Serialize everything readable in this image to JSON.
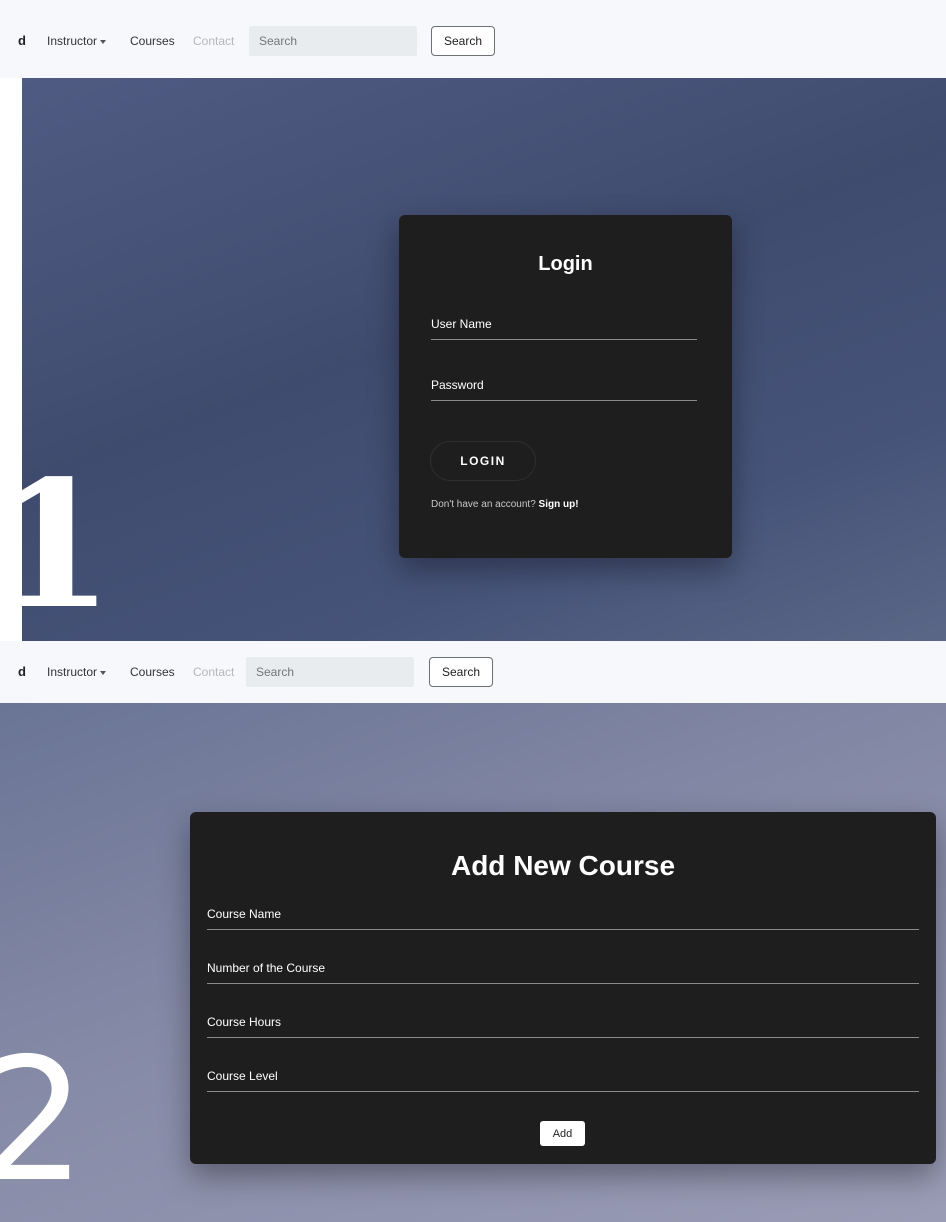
{
  "screens": [
    {
      "step_number": "1",
      "navbar": {
        "brand_glyph": "d",
        "items": [
          {
            "label": "Instructor",
            "has_dropdown": true
          },
          {
            "label": "Courses"
          },
          {
            "label": "Contact",
            "disabled": true
          }
        ],
        "search_placeholder": "Search",
        "search_button_label": "Search"
      },
      "login_form": {
        "title": "Login",
        "username_placeholder": "User Name",
        "password_placeholder": "Password",
        "submit_label": "LOGIN",
        "signup_prompt": "Don't have an account?",
        "signup_link": "Sign up!"
      }
    },
    {
      "step_number": "2",
      "navbar": {
        "brand_glyph": "d",
        "items": [
          {
            "label": "Instructor",
            "has_dropdown": true
          },
          {
            "label": "Courses"
          },
          {
            "label": "Contact",
            "disabled": true
          }
        ],
        "search_placeholder": "Search",
        "search_button_label": "Search"
      },
      "course_form": {
        "title": "Add New Course",
        "fields": [
          {
            "placeholder": "Course Name"
          },
          {
            "placeholder": "Number of the Course"
          },
          {
            "placeholder": "Course Hours"
          },
          {
            "placeholder": "Course Level"
          }
        ],
        "submit_label": "Add"
      }
    }
  ],
  "colors": {
    "navbar_bg": "#f6f8fb",
    "card_bg": "#1e1e1e",
    "hero1_bg": "#46527a",
    "hero2_bg": "#858aa6"
  }
}
